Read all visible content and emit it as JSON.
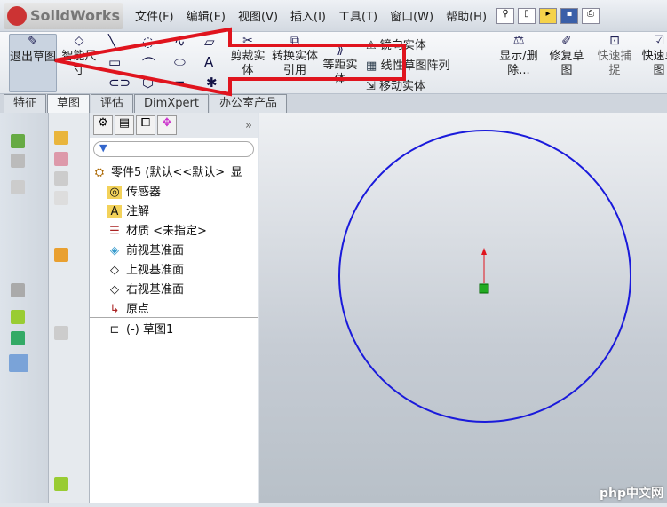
{
  "app": {
    "logo": "SolidWorks"
  },
  "menu": [
    "文件(F)",
    "编辑(E)",
    "视图(V)",
    "插入(I)",
    "工具(T)",
    "窗口(W)",
    "帮助(H)"
  ],
  "toolbar": {
    "exit_sketch": "退出草图",
    "smart_dim": "智能尺寸",
    "trim": "剪裁实体",
    "convert": "转换实体引用",
    "offset": "等距实体",
    "mirror": "镜向实体",
    "linear_pattern": "线性草图阵列",
    "move": "移动实体",
    "display_delete": "显示/删除...",
    "repair": "修复草图",
    "quick_snap": "快速捕捉",
    "quick": "快速草图"
  },
  "tabs": [
    "特征",
    "草图",
    "评估",
    "DimXpert",
    "办公室产品"
  ],
  "active_tab": "草图",
  "tree": {
    "filter_icon": "filter-icon",
    "nodes": [
      "零件5 (默认<<默认>_显",
      "传感器",
      "注解",
      "材质 <未指定>",
      "前视基准面",
      "上视基准面",
      "右视基准面",
      "原点",
      "(-) 草图1"
    ]
  },
  "canvas": {
    "circle_color": "#1a1adb",
    "annotation_color": "#e0141e"
  },
  "watermark": "php中文网"
}
